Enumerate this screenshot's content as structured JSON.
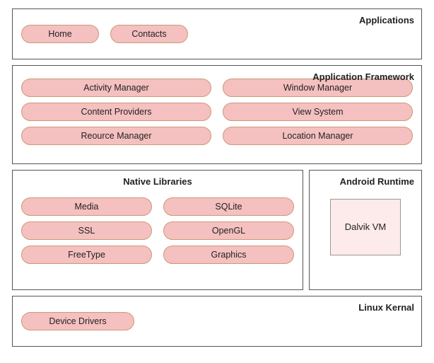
{
  "layers": {
    "applications": {
      "label": "Applications",
      "buttons": [
        "Home",
        "Contacts"
      ]
    },
    "framework": {
      "label": "Application Framework",
      "buttons": [
        "Activity Manager",
        "Window Manager",
        "Content Providers",
        "View System",
        "Reource Manager",
        "Location  Manager"
      ]
    },
    "native": {
      "label": "Native Libraries",
      "buttons": [
        "Media",
        "SQLite",
        "SSL",
        "OpenGL",
        "FreeType",
        "Graphics"
      ]
    },
    "runtime": {
      "label": "Android Runtime",
      "dalvik": "Dalvik VM"
    },
    "linux": {
      "label": "Linux Kernal",
      "buttons": [
        "Device Drivers"
      ]
    }
  }
}
